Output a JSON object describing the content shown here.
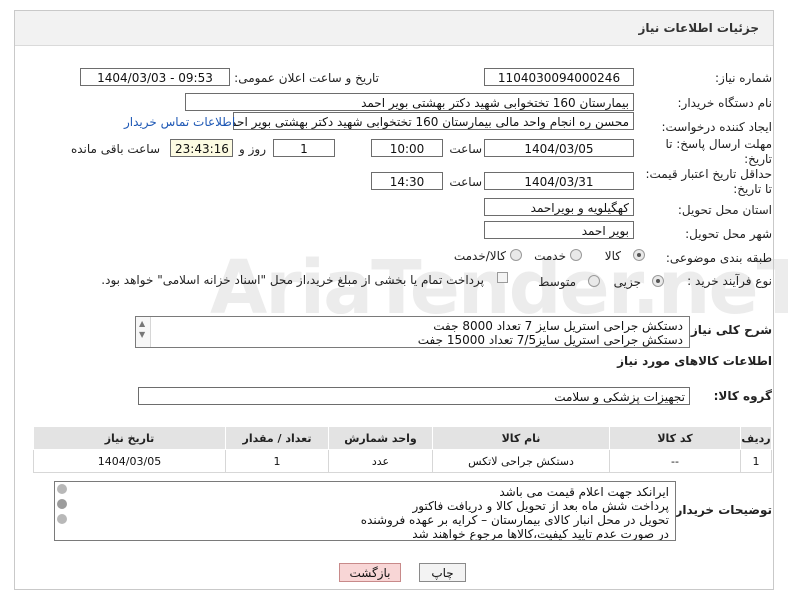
{
  "header": {
    "title": "جزئیات اطلاعات نیاز"
  },
  "watermark": "AriaTender.neT",
  "fields": {
    "need_number_label": "شماره نیاز:",
    "need_number": "1104030094000246",
    "announce_label": "تاریخ و ساعت اعلان عمومی:",
    "announce_value": "1404/03/03 - 09:53",
    "buyer_org_label": "نام دستگاه خریدار:",
    "buyer_org": "بیمارستان 160 تختخوابی شهید دکتر بهشتی بویر احمد",
    "creator_label": "ایجاد کننده درخواست:",
    "creator": "محسن ره انجام واحد مالی بیمارستان 160 تختخوابی شهید دکتر بهشتی بویر احمد",
    "contact_link": "اطلاعات تماس خریدار",
    "deadline_label_1": "مهلت ارسال پاسخ: تا",
    "deadline_label_2": "تاریخ:",
    "deadline_date": "1404/03/05",
    "time_label": "ساعت",
    "deadline_time": "10:00",
    "days_value": "1",
    "days_label": "روز و",
    "remaining_time": "23:43:16",
    "remaining_label": "ساعت باقی مانده",
    "min_price_label_1": "حداقل تاریخ اعتبار قیمت:",
    "min_price_label_2": "تا تاریخ:",
    "min_price_date": "1404/03/31",
    "min_price_time_label": "ساعت",
    "min_price_time": "14:30",
    "province_label": "استان محل تحویل:",
    "province": "کهگیلویه و بویراحمد",
    "city_label": "شهر محل تحویل:",
    "city": "بویر احمد",
    "category_label": "طبقه بندی موضوعی:",
    "category_options": [
      "کالا",
      "خدمت",
      "کالا/خدمت"
    ],
    "process_label": "نوع فرآیند خرید :",
    "process_options": [
      "جزیی",
      "متوسط"
    ],
    "payment_note": "پرداخت تمام یا بخشی از مبلغ خرید،از محل \"اسناد خزانه اسلامی\" خواهد بود."
  },
  "description": {
    "label": "شرح کلی نیاز:",
    "lines": [
      "دستکش جراحی استریل سایز 7 تعداد 8000 جفت",
      "دستکش جراحی استریل سایز7/5 تعداد 15000 جفت"
    ]
  },
  "goods": {
    "section_title": "اطلاعات کالاهای مورد نیاز",
    "group_label": "گروه کالا:",
    "group_value": "تجهیزات پزشکی و سلامت",
    "columns": [
      "ردیف",
      "کد کالا",
      "نام کالا",
      "واحد شمارش",
      "تعداد / مقدار",
      "تاریخ نیاز"
    ],
    "rows": [
      {
        "row": "1",
        "code": "--",
        "name": "دستکش جراحی لاتکس",
        "unit": "عدد",
        "qty": "1",
        "date": "1404/03/05"
      }
    ]
  },
  "buyer_notes": {
    "label": "توضیحات خریدار:",
    "lines": [
      "ایرانکد جهت اعلام قیمت می باشد",
      "پرداخت شش ماه بعد از تحویل کالا و دریافت فاکتور",
      "تحویل در محل انبار کالای بیمارستان – کرایه بر عهده فروشنده",
      "در صورت عدم تایید کیفیت،کالاها مرجوع خواهند شد"
    ]
  },
  "buttons": {
    "print": "چاپ",
    "back": "بازگشت"
  }
}
